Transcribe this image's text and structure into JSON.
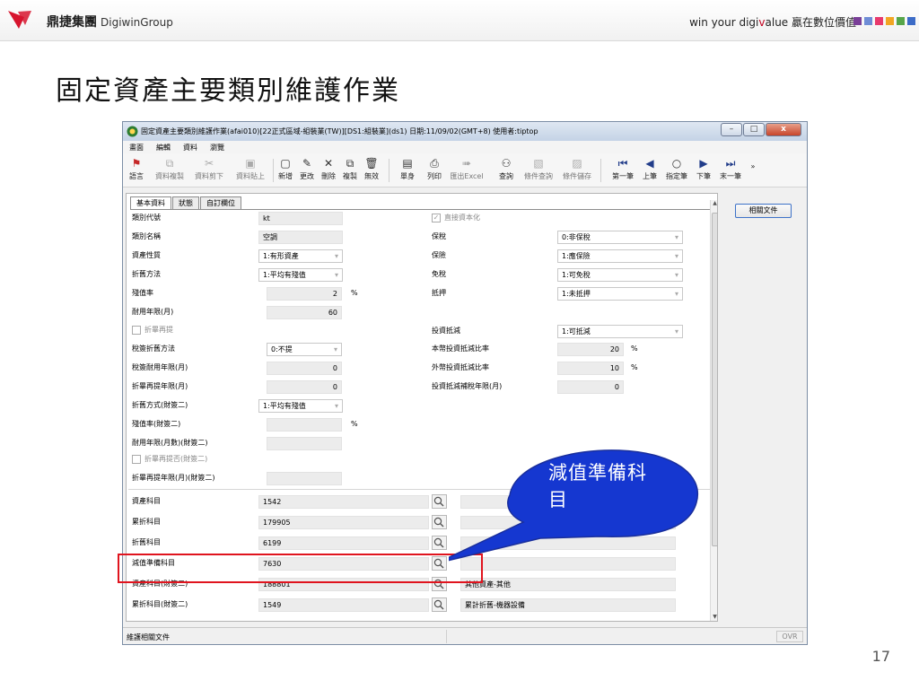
{
  "header": {
    "brand_name": "鼎捷集團",
    "brand_group": "DigiwinGroup",
    "slogan_prefix": "win your digi",
    "slogan_accent": "v",
    "slogan_suffix": "alue 贏在數位價值",
    "block_colors": [
      "#7a3f98",
      "#6f8dd6",
      "#e83a6d",
      "#f2a623",
      "#57a64a",
      "#3d6cc7"
    ]
  },
  "slide": {
    "title": "固定資產主要類別維護作業",
    "page_number": "17"
  },
  "window": {
    "title": "固定資產主要類別維護作業(afai010)[22正式區域-組裝業(TW)][DS1:組裝業](ds1) 日期:11/09/02(GMT+8) 使用者:tiptop",
    "buttons": {
      "minimize": "–",
      "maximize": "□",
      "close": "x"
    },
    "menu": [
      "畫面",
      "編輯",
      "資料",
      "瀏覽"
    ],
    "toolbar": {
      "lang": "語言",
      "copy_data": "資料複製",
      "cut_data": "資料剪下",
      "paste_data": "資料貼上",
      "new": "新增",
      "modify": "更改",
      "delete": "刪除",
      "duplicate": "複製",
      "void": "無效",
      "single": "單身",
      "print": "列印",
      "export_excel": "匯出Excel",
      "query": "查詢",
      "cond_query": "條件查詢",
      "cond_save": "條件儲存",
      "first": "第一筆",
      "prev": "上筆",
      "goto": "指定筆",
      "next": "下筆",
      "last": "末一筆",
      "more": "»"
    }
  },
  "tabs": [
    "基本資料",
    "狀態",
    "自訂欄位"
  ],
  "form": {
    "category_code": {
      "label": "類別代號",
      "value": "kt"
    },
    "category_name": {
      "label": "類別名稱",
      "value": "空調"
    },
    "asset_nature": {
      "label": "資產性質",
      "value": "1:有形資產"
    },
    "depr_method": {
      "label": "折舊方法",
      "value": "1:平均有殘值"
    },
    "residual_rate": {
      "label": "殘值率",
      "value": "2",
      "unit": "%"
    },
    "useful_life": {
      "label": "耐用年限(月)",
      "value": "60"
    },
    "depr_reprovision": {
      "label": "折畢再提"
    },
    "tax_depr_method": {
      "label": "稅簽折舊方法",
      "value": "0:不提"
    },
    "tax_useful_life": {
      "label": "稅簽耐用年限(月)",
      "value": "0"
    },
    "reprov_life": {
      "label": "折畢再提年限(月)",
      "value": "0"
    },
    "depr_method_2": {
      "label": "折舊方式(財簽二)",
      "value": "1:平均有殘值"
    },
    "residual_rate_2": {
      "label": "殘值率(財簽二)",
      "value": "",
      "unit": "%"
    },
    "useful_life_2": {
      "label": "耐用年限(月數)(財簽二)",
      "value": ""
    },
    "reprov_flag_2": {
      "label": "折畢再提否(財簽二)"
    },
    "reprov_life_2": {
      "label": "折畢再提年限(月)(財簽二)",
      "value": ""
    },
    "direct_capitalize": {
      "label": "直接資本化"
    },
    "bonded": {
      "label": "保稅",
      "value": "0:非保稅"
    },
    "insurance": {
      "label": "保險",
      "value": "1:應保險"
    },
    "tax_exempt": {
      "label": "免稅",
      "value": "1:可免稅"
    },
    "pledge": {
      "label": "抵押",
      "value": "1:未抵押"
    },
    "invest_deduct": {
      "label": "投資抵減",
      "value": "1:可抵減"
    },
    "local_deduct_rate": {
      "label": "本幣投資抵減比率",
      "value": "20",
      "unit": "%"
    },
    "foreign_deduct_rate": {
      "label": "外幣投資抵減比率",
      "value": "10",
      "unit": "%"
    },
    "deduct_years": {
      "label": "投資抵減補稅年限(月)",
      "value": "0"
    }
  },
  "accounts": [
    {
      "label": "資產科目",
      "code": "1542",
      "name": ""
    },
    {
      "label": "累折科目",
      "code": "179905",
      "name": ""
    },
    {
      "label": "折舊科目",
      "code": "6199",
      "name": ""
    },
    {
      "label": "減值準備科目",
      "code": "7630",
      "name": ""
    },
    {
      "label": "資產科目(財簽二)",
      "code": "188801",
      "name": "其他資產-其他"
    },
    {
      "label": "累折科目(財簽二)",
      "code": "1549",
      "name": "累計折舊-機器設備"
    }
  ],
  "side": {
    "related_docs_button": "相關文件"
  },
  "status": {
    "text": "維護相關文件",
    "ovr": "OVR"
  },
  "annotation": {
    "callout_text": "減值準備科目",
    "callout_color": "#1537d0",
    "highlight_color": "#e0141e"
  }
}
